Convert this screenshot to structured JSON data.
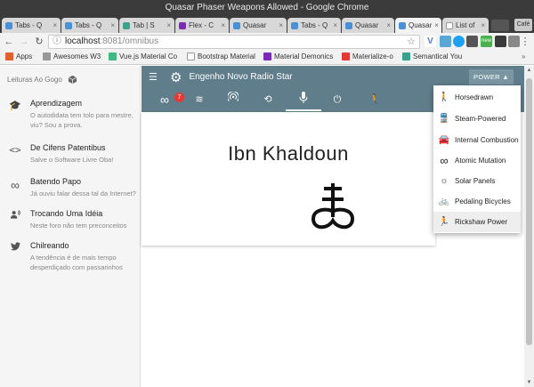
{
  "window": {
    "title": "Quasar Phaser Weapons Allowed - Google Chrome"
  },
  "tabs": [
    {
      "label": "Tabs - Q",
      "color": "#4a90d9"
    },
    {
      "label": "Tabs - Q",
      "color": "#4a90d9"
    },
    {
      "label": "Tab | S",
      "color": "#3aa38c"
    },
    {
      "label": "Flex - C",
      "color": "#7b2bb5"
    },
    {
      "label": "Quasar",
      "color": "#4a90d9"
    },
    {
      "label": "Tabs - Q",
      "color": "#4a90d9"
    },
    {
      "label": "Quasar",
      "color": "#4a90d9"
    },
    {
      "label": "Quasar",
      "color": "#4a90d9"
    },
    {
      "label": "List of",
      "color": "#ffffff"
    }
  ],
  "window_user": "Café",
  "address": {
    "url_host": "localhost",
    "url_rest": ":8081/omnibus"
  },
  "bookmarks": [
    {
      "label": "Apps",
      "color": "#e06030"
    },
    {
      "label": "Awesomes W3",
      "color": "#999999"
    },
    {
      "label": "Vue.js Material Co",
      "color": "#41b883"
    },
    {
      "label": "Bootstrap Material",
      "color": "#cccccc"
    },
    {
      "label": "Material Demonics",
      "color": "#7b2bb5"
    },
    {
      "label": "Materialize-o",
      "color": "#e53935"
    },
    {
      "label": "Semantical You",
      "color": "#3aa38c"
    }
  ],
  "sidebar": {
    "header": "Leituras Ao Gogo",
    "items": [
      {
        "icon": "graduation-cap-icon",
        "title": "Aprendizagem",
        "sub": "O autodidata tem tolo para mestre, viu? Sou a prova."
      },
      {
        "icon": "code-icon",
        "title": "De Cifens Patentibus",
        "sub": "Salve o Software Livre Oba!"
      },
      {
        "icon": "infinity-icon",
        "title": "Batendo Papo",
        "sub": "Já ouviu falar dessa tal da Internet?"
      },
      {
        "icon": "record-voice-icon",
        "title": "Trocando Uma Idéia",
        "sub": "Neste foro não tem preconceitos"
      },
      {
        "icon": "twitter-icon",
        "title": "Chilreando",
        "sub": "A tendência é de mais tempo desperdiçado com passarinhos"
      }
    ]
  },
  "app": {
    "title": "Engenho Novo Radio Star",
    "power_label": "POWER",
    "tab_badge": "7",
    "card_title": "Ibn Khaldoun",
    "accent": "#607d8b"
  },
  "menu": {
    "items": [
      {
        "icon": "walk-icon",
        "label": "Horsedrawn"
      },
      {
        "icon": "train-icon",
        "label": "Steam-Powered"
      },
      {
        "icon": "car-icon",
        "label": "Internal Combustion"
      },
      {
        "icon": "infinity-icon",
        "label": "Atomic Mutation"
      },
      {
        "icon": "sun-icon",
        "label": "Solar Panels"
      },
      {
        "icon": "bike-icon",
        "label": "Pedaling Bicycles"
      },
      {
        "icon": "run-icon",
        "label": "Rickshaw Power"
      }
    ]
  }
}
